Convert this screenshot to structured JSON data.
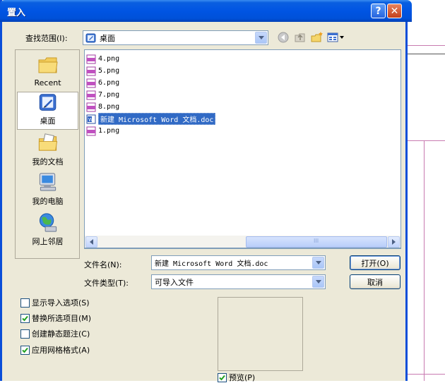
{
  "window": {
    "title": "置入",
    "help_symbol": "?",
    "close_symbol": "✕"
  },
  "look_in": {
    "label": "查找范围(I):",
    "value": "桌面"
  },
  "toolbar": {
    "icons": [
      "back-icon",
      "up-folder-icon",
      "new-folder-icon",
      "views-menu-icon"
    ]
  },
  "places": [
    {
      "label": "Recent",
      "icon": "recent-folder-icon"
    },
    {
      "label": "桌面",
      "icon": "desktop-icon",
      "selected": true
    },
    {
      "label": "我的文档",
      "icon": "my-documents-icon"
    },
    {
      "label": "我的电脑",
      "icon": "my-computer-icon"
    },
    {
      "label": "网上邻居",
      "icon": "network-places-icon"
    }
  ],
  "files": [
    {
      "name": "4.png",
      "type": "png"
    },
    {
      "name": "5.png",
      "type": "png"
    },
    {
      "name": "6.png",
      "type": "png"
    },
    {
      "name": "7.png",
      "type": "png"
    },
    {
      "name": "8.png",
      "type": "png"
    },
    {
      "name": "新建 Microsoft Word 文档.doc",
      "type": "doc",
      "selected": true
    },
    {
      "name": "1.png",
      "type": "png"
    }
  ],
  "scrollbar": {
    "thumb_grip": "III"
  },
  "filename": {
    "label": "文件名(N):",
    "value": "新建 Microsoft Word 文档.doc"
  },
  "filetype": {
    "label": "文件类型(T):",
    "value": "可导入文件"
  },
  "buttons": {
    "open": "打开(O)",
    "cancel": "取消"
  },
  "options": [
    {
      "label": "显示导入选项(S)",
      "checked": false
    },
    {
      "label": "替换所选项目(M)",
      "checked": true
    },
    {
      "label": "创建静态题注(C)",
      "checked": false
    },
    {
      "label": "应用网格格式(A)",
      "checked": true
    }
  ],
  "preview": {
    "label": "预览(P)",
    "checked": true
  },
  "colors": {
    "titlebar": "#0054e3",
    "selection": "#316ac5",
    "dialog_bg": "#ece9d8"
  }
}
